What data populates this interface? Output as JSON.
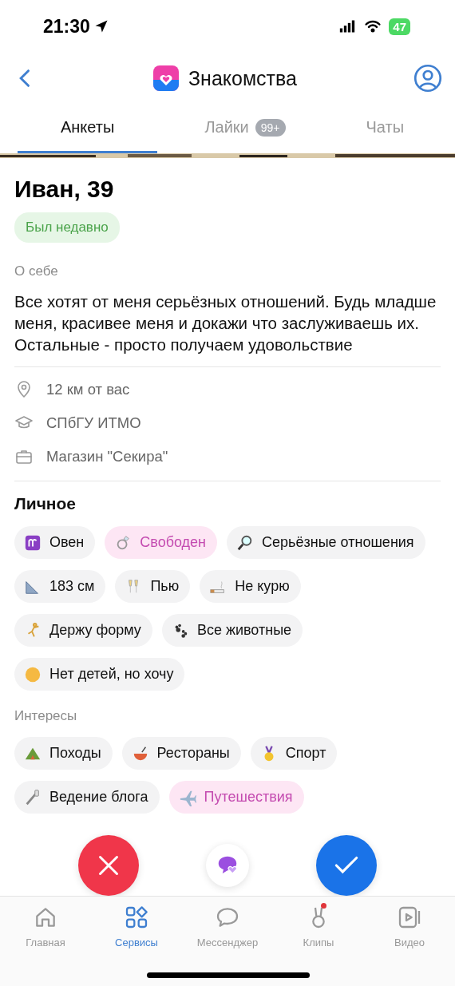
{
  "status_bar": {
    "time": "21:30",
    "battery": "47"
  },
  "header": {
    "title": "Знакомства"
  },
  "tabs": [
    {
      "label": "Анкеты",
      "selected": true
    },
    {
      "label": "Лайки",
      "badge": "99+",
      "selected": false
    },
    {
      "label": "Чаты",
      "selected": false
    }
  ],
  "profile": {
    "name": "Иван, 39",
    "presence": "Был недавно",
    "about_label": "О себе",
    "about": "Все хотят от меня серьёзных отношений. Будь младше меня, красивее меня и докажи что заслуживаешь их.\nОстальные - просто получаем удовольствие",
    "details": [
      {
        "kind": "location",
        "text": "12 км от вас"
      },
      {
        "kind": "education",
        "text": "СПбГУ ИТМО"
      },
      {
        "kind": "work",
        "text": "Магазин \"Секира\""
      }
    ]
  },
  "personal": {
    "title": "Личное",
    "chips": [
      {
        "label": "Овен",
        "highlighted": false
      },
      {
        "label": "Свободен",
        "highlighted": true
      },
      {
        "label": "Серьёзные отношения",
        "highlighted": false
      },
      {
        "label": "183 см",
        "highlighted": false
      },
      {
        "label": "Пью",
        "highlighted": false
      },
      {
        "label": "Не курю",
        "highlighted": false
      },
      {
        "label": "Держу форму",
        "highlighted": false
      },
      {
        "label": "Все животные",
        "highlighted": false
      },
      {
        "label": "Нет детей, но хочу",
        "highlighted": false
      }
    ]
  },
  "interests": {
    "title": "Интересы",
    "chips": [
      {
        "label": "Походы",
        "highlighted": false
      },
      {
        "label": "Рестораны",
        "highlighted": false
      },
      {
        "label": "Спорт",
        "highlighted": false
      },
      {
        "label": "Ведение блога",
        "highlighted": false
      },
      {
        "label": "Путешествия",
        "highlighted": true
      }
    ]
  },
  "bottom_nav": [
    {
      "label": "Главная",
      "selected": false,
      "dot": false
    },
    {
      "label": "Сервисы",
      "selected": true,
      "dot": false
    },
    {
      "label": "Мессенджер",
      "selected": false,
      "dot": false
    },
    {
      "label": "Клипы",
      "selected": false,
      "dot": true
    },
    {
      "label": "Видео",
      "selected": false,
      "dot": false
    }
  ]
}
